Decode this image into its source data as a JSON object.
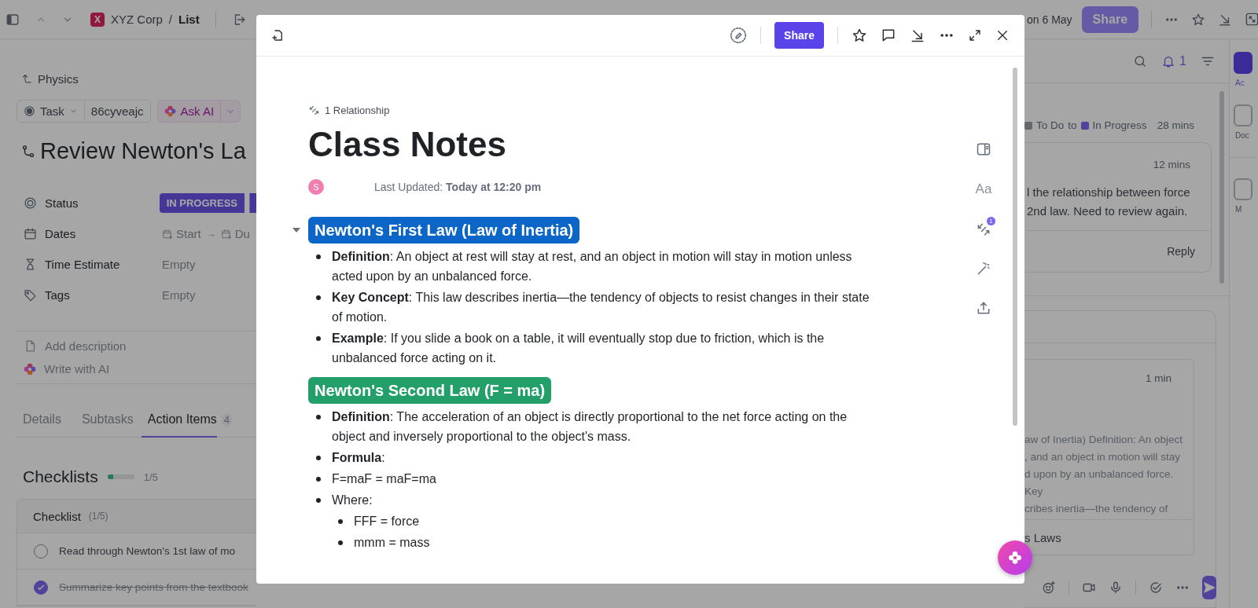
{
  "app_bar": {
    "workspace_logo": "X",
    "workspace": "XYZ Corp",
    "separator": "/",
    "list": "List",
    "due": "on 6 May",
    "share": "Share"
  },
  "task": {
    "parent": "Physics",
    "type": "Task",
    "id": "86cyveajc",
    "ask_ai": "Ask AI",
    "title": "Review Newton's La",
    "fields": [
      {
        "kind": "status",
        "label": "Status",
        "value": "IN PROGRESS"
      },
      {
        "kind": "dates",
        "label": "Dates",
        "start": "Start",
        "arrow": "→",
        "due": "Du"
      },
      {
        "kind": "text",
        "label": "Time Estimate",
        "value": "Empty"
      },
      {
        "kind": "tags",
        "label": "Tags",
        "value": "Empty"
      }
    ],
    "description": [
      {
        "kind": "doc",
        "label": "Add description"
      },
      {
        "kind": "ai",
        "label": "Write with AI"
      }
    ],
    "tabs": [
      {
        "label": "Details",
        "selected": false
      },
      {
        "label": "Subtasks",
        "selected": false
      },
      {
        "label": "Action Items",
        "selected": true,
        "count": "4"
      }
    ],
    "checklists": {
      "title": "Checklists",
      "level": 0.2,
      "progress": "1/5",
      "name": "Checklist",
      "count": "(1/5)",
      "items": [
        {
          "text": "Read through Newton's 1st law of mo",
          "checked": false
        },
        {
          "text": "Summarize key points from the textbook",
          "checked": true
        }
      ]
    }
  },
  "activity": {
    "notifications": "1",
    "status_change": {
      "from": {
        "label": "To Do"
      },
      "joiner": "to",
      "to": {
        "label": "In Progress"
      },
      "time": "28 mins"
    },
    "comment": {
      "time": "12 mins",
      "lines": [
        "l the relationship between force",
        "2nd law. Need to review again."
      ],
      "reply": "Reply"
    },
    "doc_comment": {
      "time": "1 min",
      "lines": [
        "aw of Inertia) Definition: An object",
        ", and an object in motion will stay",
        "d upon by an unbalanced force. Key",
        "cribes inertia—the tendency of"
      ],
      "doc": "s Laws"
    }
  },
  "sidebar": [
    {
      "label": "Ac",
      "selected": true
    },
    {
      "label": "Doc",
      "selected": false
    },
    {
      "label": "M",
      "selected": false
    }
  ],
  "doc_modal": {
    "share": "Share",
    "relationship": "1 Relationship",
    "title": "Class Notes",
    "avatar": "S",
    "updated": "Last Updated: **Today at 12:20 pm**",
    "text_icon": "Aa",
    "relation_badge": "1",
    "sections": [
      {
        "heading": "Newton's First Law (Law of Inertia)",
        "color": "#0b66c8",
        "expanded": true,
        "items": [
          {
            "text": "**Definition**: An object at rest will stay at rest, and an object in motion will stay in motion unless acted upon by an unbalanced force."
          },
          {
            "text": "**Key Concept**: This law describes inertia—the tendency of objects to resist changes in their state of motion."
          },
          {
            "text": "**Example**: If you slide a book on a table, it will eventually stop due to friction, which is the unbalanced force acting on it."
          }
        ]
      },
      {
        "heading": "Newton's Second Law (F = ma)",
        "color": "#23a06a",
        "items": [
          {
            "text": "**Definition**: The acceleration of an object is directly proportional to the net force acting on the object and inversely proportional to the object's mass."
          },
          {
            "text": "**Formula**:"
          },
          {
            "text": "F=maF = maF=ma"
          },
          {
            "text": "Where:",
            "children": [
              {
                "text": "FFF = force"
              },
              {
                "text": "mmm = mass"
              }
            ]
          }
        ]
      }
    ]
  }
}
